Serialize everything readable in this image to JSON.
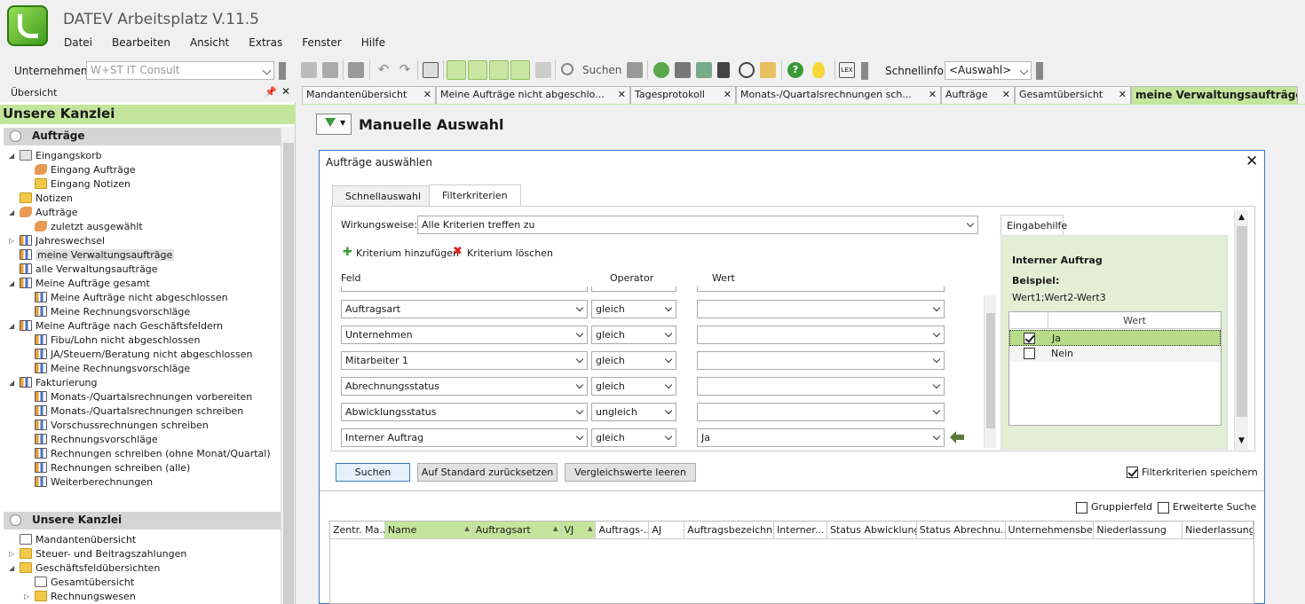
{
  "app": {
    "title": "DATEV Arbeitsplatz V.11.5",
    "menu": [
      "Datei",
      "Bearbeiten",
      "Ansicht",
      "Extras",
      "Fenster",
      "Hilfe"
    ]
  },
  "toolbar": {
    "unternehmen_label": "Unternehmen:",
    "unternehmen_value": "W+ST IT Consult",
    "suchen_label": "Suchen",
    "schnellinfo_label": "Schnellinfo:",
    "schnellinfo_value": "<Auswahl>"
  },
  "left": {
    "overview_label": "Übersicht",
    "section_title": "Unsere Kanzlei",
    "group1_title": "Aufträge",
    "group1_items": [
      {
        "label": "Eingangskorb",
        "level": 0,
        "icon": "inbox",
        "exp": "◢"
      },
      {
        "label": "Eingang Aufträge",
        "level": 1,
        "icon": "hand",
        "exp": ""
      },
      {
        "label": "Eingang Notizen",
        "level": 1,
        "icon": "folder",
        "exp": ""
      },
      {
        "label": "Notizen",
        "level": 0,
        "icon": "folder",
        "exp": ""
      },
      {
        "label": "Aufträge",
        "level": 0,
        "icon": "hand",
        "exp": "◢"
      },
      {
        "label": "zuletzt ausgewählt",
        "level": 1,
        "icon": "hand",
        "exp": ""
      },
      {
        "label": "Jahreswechsel",
        "level": 0,
        "icon": "chart",
        "exp": "▷"
      },
      {
        "label": "meine Verwaltungsaufträge",
        "level": 0,
        "icon": "chart",
        "exp": "",
        "selected": true
      },
      {
        "label": "alle Verwaltungsaufträge",
        "level": 0,
        "icon": "chart",
        "exp": ""
      },
      {
        "label": "Meine Aufträge gesamt",
        "level": 0,
        "icon": "chart",
        "exp": "◢"
      },
      {
        "label": "Meine Aufträge nicht abgeschlossen",
        "level": 1,
        "icon": "chart",
        "exp": ""
      },
      {
        "label": "Meine Rechnungsvorschläge",
        "level": 1,
        "icon": "chart",
        "exp": ""
      },
      {
        "label": "Meine Aufträge nach Geschäftsfeldern",
        "level": 0,
        "icon": "chart",
        "exp": "◢"
      },
      {
        "label": "Fibu/Lohn nicht abgeschlossen",
        "level": 1,
        "icon": "chart",
        "exp": ""
      },
      {
        "label": "JA/Steuern/Beratung nicht abgeschlossen",
        "level": 1,
        "icon": "chart",
        "exp": ""
      },
      {
        "label": "Meine Rechnungsvorschläge",
        "level": 1,
        "icon": "chart",
        "exp": ""
      },
      {
        "label": "Fakturierung",
        "level": 0,
        "icon": "chart",
        "exp": "◢"
      },
      {
        "label": "Monats-/Quartalsrechnungen vorbereiten",
        "level": 1,
        "icon": "chart",
        "exp": ""
      },
      {
        "label": "Monats-/Quartalsrechnungen schreiben",
        "level": 1,
        "icon": "chart",
        "exp": ""
      },
      {
        "label": "Vorschussrechnungen schreiben",
        "level": 1,
        "icon": "chart",
        "exp": ""
      },
      {
        "label": "Rechnungsvorschläge",
        "level": 1,
        "icon": "chart",
        "exp": ""
      },
      {
        "label": "Rechnungen schreiben (ohne Monat/Quartal)",
        "level": 1,
        "icon": "chart",
        "exp": ""
      },
      {
        "label": "Rechnungen schreiben (alle)",
        "level": 1,
        "icon": "chart",
        "exp": ""
      },
      {
        "label": "Weiterberechnungen",
        "level": 1,
        "icon": "chart",
        "exp": ""
      }
    ],
    "group2_title": "Unsere Kanzlei",
    "group2_items": [
      {
        "label": "Mandantenübersicht",
        "level": 0,
        "icon": "doc",
        "exp": ""
      },
      {
        "label": "Steuer- und Beitragszahlungen",
        "level": 0,
        "icon": "folder",
        "exp": "▷"
      },
      {
        "label": "Geschäftsfeldübersichten",
        "level": 0,
        "icon": "folder",
        "exp": "◢"
      },
      {
        "label": "Gesamtübersicht",
        "level": 1,
        "icon": "doc",
        "exp": ""
      },
      {
        "label": "Rechnungswesen",
        "level": 1,
        "icon": "folder",
        "exp": "▷"
      }
    ]
  },
  "tabs": [
    {
      "label": "Mandantenübersicht",
      "w": 151
    },
    {
      "label": "Meine Aufträge nicht abgeschlo...",
      "w": 219
    },
    {
      "label": "Tagesprotokoll",
      "w": 119
    },
    {
      "label": "Monats-/Quartalsrechnungen sch...",
      "w": 231
    },
    {
      "label": "Aufträge",
      "w": 83
    },
    {
      "label": "Gesamtübersicht",
      "w": 131
    },
    {
      "label": "meine Verwaltungsaufträge",
      "w": 188,
      "active": true
    }
  ],
  "page_title": "Manuelle Auswahl",
  "dialog": {
    "title": "Aufträge auswählen",
    "close": "✕",
    "tab_quick": "Schnellauswahl",
    "tab_filter": "Filterkriterien",
    "wirkungsweise_label": "Wirkungsweise:",
    "wirkungsweise_value": "Alle Kriterien treffen zu",
    "add_criterion": "Kriterium hinzufügen",
    "delete_criterion": "Kriterium löschen",
    "col_feld": "Feld",
    "col_operator": "Operator",
    "col_wert": "Wert",
    "rows": [
      {
        "feld": "Auftragsart",
        "op": "gleich",
        "wert": ""
      },
      {
        "feld": "Unternehmen",
        "op": "gleich",
        "wert": ""
      },
      {
        "feld": "Mitarbeiter 1",
        "op": "gleich",
        "wert": ""
      },
      {
        "feld": "Abrechnungsstatus",
        "op": "gleich",
        "wert": ""
      },
      {
        "feld": "Abwicklungsstatus",
        "op": "ungleich",
        "wert": ""
      },
      {
        "feld": "Interner Auftrag",
        "op": "gleich",
        "wert": "Ja"
      }
    ],
    "help_tab": "Eingabehilfe",
    "help_title": "Interner Auftrag",
    "help_example_label": "Beispiel:",
    "help_example": "Wert1;Wert2-Wert3",
    "help_col": "Wert",
    "help_options": [
      {
        "label": "Ja",
        "checked": true
      },
      {
        "label": "Nein",
        "checked": false
      }
    ],
    "btn_search": "Suchen",
    "btn_reset": "Auf Standard zurücksetzen",
    "btn_clear": "Vergleichswerte leeren",
    "save_filter": "Filterkriterien speichern",
    "group_field": "Gruppierfeld",
    "extended_search": "Erweiterte Suche"
  },
  "grid": {
    "columns": [
      {
        "label": "Zentr. Ma...",
        "w": 62,
        "sort": false
      },
      {
        "label": "Name",
        "w": 99,
        "sort": true
      },
      {
        "label": "Auftragsart",
        "w": 100,
        "sort": true
      },
      {
        "label": "VJ",
        "w": 39,
        "sort": true
      },
      {
        "label": "Auftrags-...",
        "w": 60,
        "sort": false
      },
      {
        "label": "AJ",
        "w": 40,
        "sort": false
      },
      {
        "label": "Auftragsbezeichn...",
        "w": 101,
        "sort": false
      },
      {
        "label": "Interner...",
        "w": 60,
        "sort": false
      },
      {
        "label": "Status Abwicklung",
        "w": 101,
        "sort": false
      },
      {
        "label": "Status  Abrechnu...",
        "w": 100,
        "sort": false
      },
      {
        "label": "Unternehmensbe...",
        "w": 100,
        "sort": false
      },
      {
        "label": "Niederlassung",
        "w": 100,
        "sort": false
      },
      {
        "label": "Niederlassungs",
        "w": 80,
        "sort": false
      }
    ]
  },
  "colors": {
    "accent_green": "#c3e59c",
    "selection_green": "#b8dd8a",
    "dialog_border": "#3a7cc0"
  }
}
